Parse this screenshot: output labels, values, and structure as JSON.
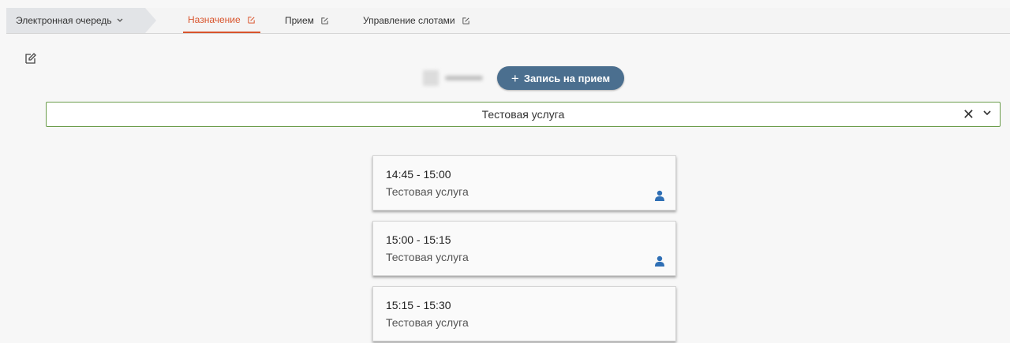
{
  "topbar": {
    "breadcrumb_label": "Электронная очередь",
    "tabs": [
      {
        "label": "Назначение"
      },
      {
        "label": "Прием"
      },
      {
        "label": "Управление слотами"
      }
    ]
  },
  "record_button": {
    "plus": "+",
    "label": "Запись на прием"
  },
  "service_select": {
    "value": "Тестовая услуга",
    "clear": "✕"
  },
  "slots": [
    {
      "time": "14:45 - 15:00",
      "service": "Тестовая услуга",
      "booked": true
    },
    {
      "time": "15:00 - 15:15",
      "service": "Тестовая услуга",
      "booked": true
    },
    {
      "time": "15:15 - 15:30",
      "service": "Тестовая услуга",
      "booked": false
    }
  ],
  "colors": {
    "accent": "#d9542c",
    "button": "#4b6f8f",
    "select_border": "#6a9c4a",
    "person_icon": "#2f6fb5"
  },
  "icons": {
    "breadcrumb": "chevron-down-icon",
    "tab": "edit-icon",
    "page": "edit-icon",
    "select": [
      "close-icon",
      "chevron-down-icon"
    ],
    "slot": "person-icon"
  }
}
